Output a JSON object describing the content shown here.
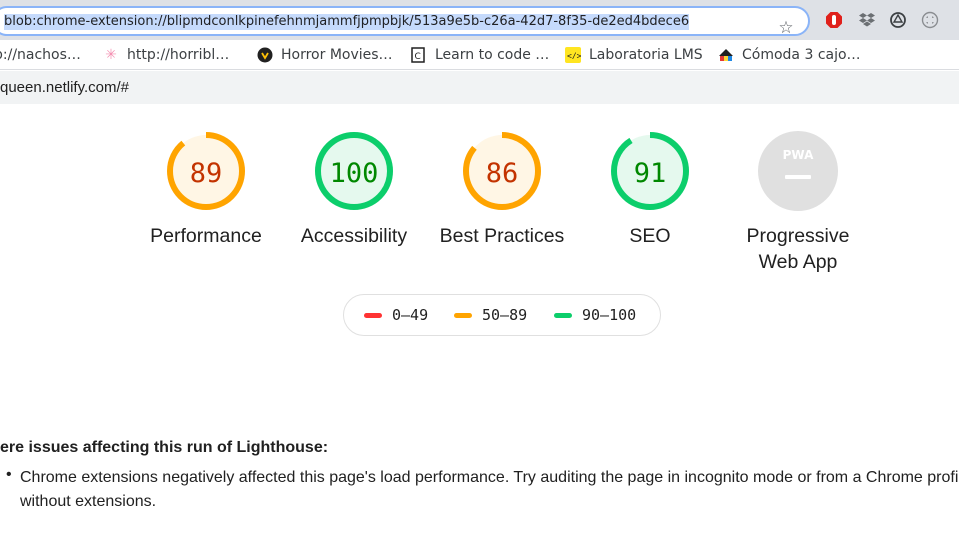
{
  "browser": {
    "url": "blob:chrome-extension://blipmdconlkpinefehnmjammfjpmpbjk/513a9e5b-c26a-42d7-8f35-de2ed4bdece6",
    "bookmarks": [
      {
        "label": "p://nachos…",
        "icon": "none"
      },
      {
        "label": "http://horribl…",
        "icon": "sparkle-icon"
      },
      {
        "label": "Horror Movies…",
        "icon": "horror-icon"
      },
      {
        "label": "Learn to code …",
        "icon": "code-icon"
      },
      {
        "label": "Laboratoria LMS",
        "icon": "laboratoria-icon"
      },
      {
        "label": "Cómoda 3 cajo…",
        "icon": "store-icon"
      }
    ]
  },
  "page": {
    "url_strip": "queen.netlify.com/#",
    "gauges": [
      {
        "score": "89",
        "label": "Performance",
        "status": "average",
        "fraction": 0.89
      },
      {
        "score": "100",
        "label": "Accessibility",
        "status": "pass",
        "fraction": 1.0
      },
      {
        "score": "86",
        "label": "Best Practices",
        "status": "average",
        "fraction": 0.86
      },
      {
        "score": "91",
        "label": "SEO",
        "status": "pass",
        "fraction": 0.91
      }
    ],
    "pwa": {
      "badge": "PWA",
      "label_line1": "Progressive",
      "label_line2": "Web App"
    },
    "legend": [
      {
        "range": "0–49",
        "color": "#ff3333"
      },
      {
        "range": "50–89",
        "color": "#ffa400"
      },
      {
        "range": "90–100",
        "color": "#0cce6b"
      }
    ],
    "warning": {
      "title": "ere issues affecting this run of Lighthouse:",
      "items": [
        "Chrome extensions negatively affected this page's load performance. Try auditing the page in incognito mode or from a Chrome profile without extensions."
      ]
    }
  },
  "colors": {
    "pass": "#0cce6b",
    "pass_text": "#008800",
    "pass_bg": "#e5f9ee",
    "average": "#ffa400",
    "average_text": "#c33300",
    "average_bg": "#fff6e5",
    "fail": "#ff3333",
    "pwa_gray": "#e0e0e0"
  }
}
